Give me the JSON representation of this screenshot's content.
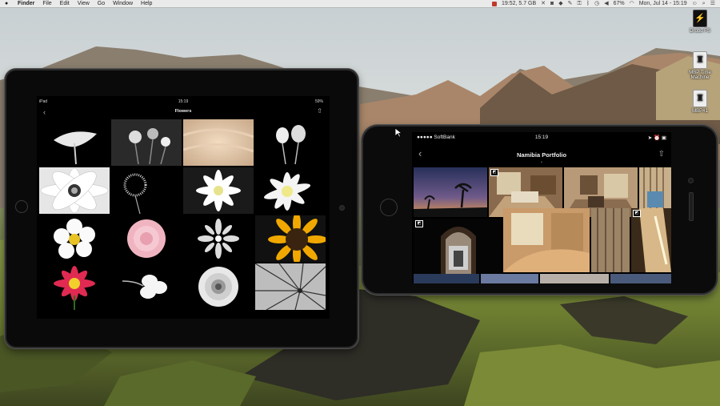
{
  "menubar": {
    "app_name": "Finder",
    "menus": [
      "File",
      "Edit",
      "View",
      "Go",
      "Window",
      "Help"
    ],
    "battery_info": "19:52, 5.7 GB",
    "wifi_percent": "67%",
    "datetime": "Mon, Jul 14 - 15:19"
  },
  "desktop_icons": [
    {
      "label": "Drobo FS",
      "icon": "drobo-icon"
    },
    {
      "label": "MBP Time Machine",
      "icon": "drive-icon"
    },
    {
      "label": "MBP#1",
      "icon": "drive-icon"
    }
  ],
  "ipad": {
    "status_left": "iPad",
    "status_time": "15:19",
    "status_battery": "59%",
    "title": "Flowers",
    "back_glyph": "‹",
    "share_glyph": "⇧"
  },
  "iphone": {
    "carrier": "●●●●● SoftBank",
    "time": "15:19",
    "status_right": "➤ ⏰ ▣",
    "title": "Namibia Portfolio",
    "chevron": "⌄",
    "back_glyph": "‹",
    "share_glyph": "⇧",
    "tag_glyph": "◩"
  },
  "colors": {
    "device_bezel": "#0b0b0b",
    "screen_bg": "#000000",
    "menubar_bg": "#ececec"
  }
}
